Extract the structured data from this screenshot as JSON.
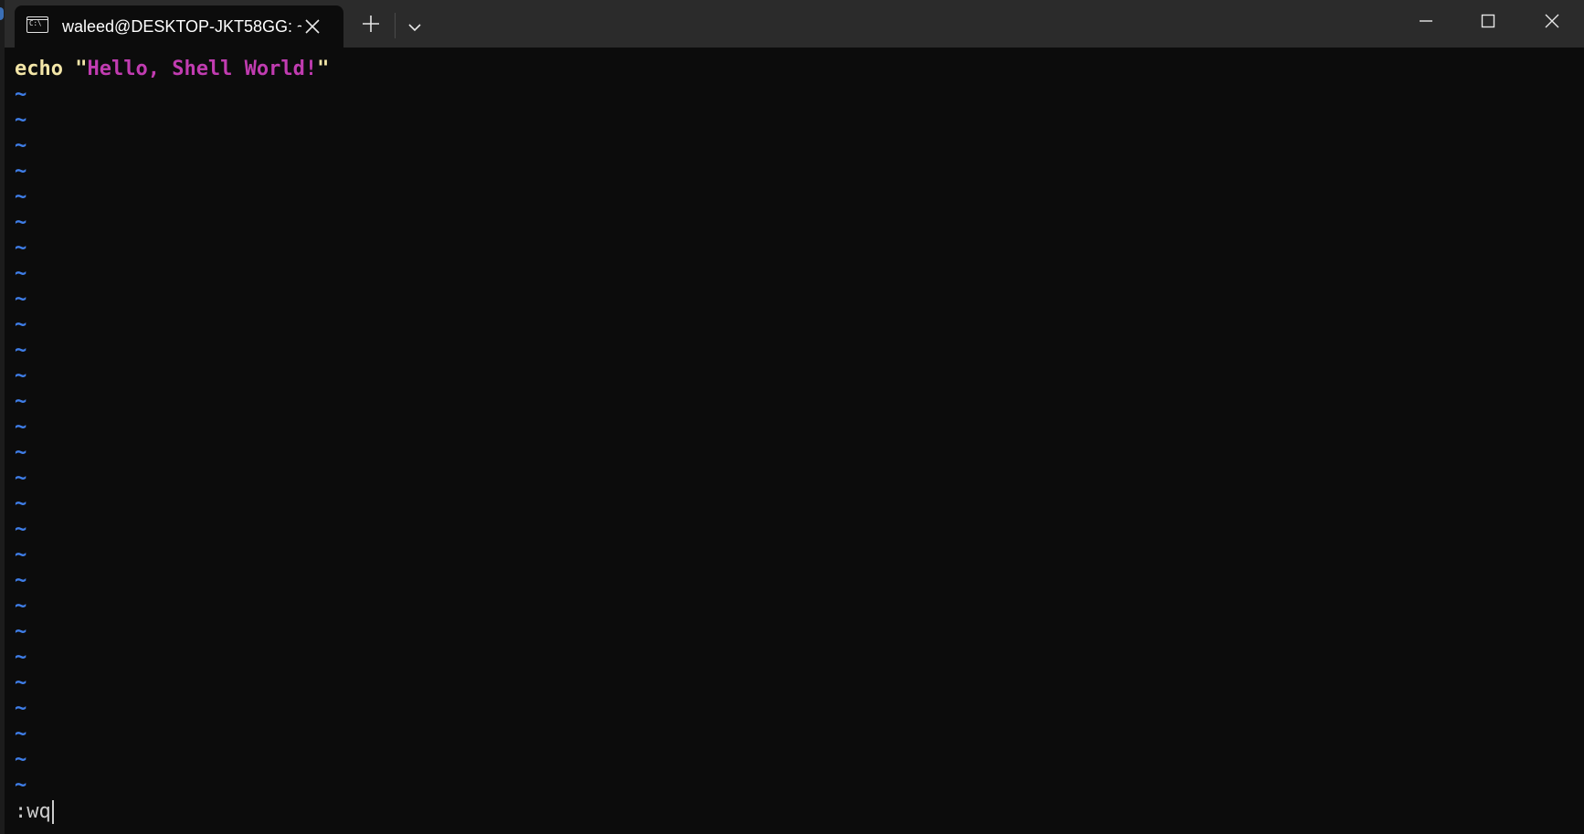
{
  "window": {
    "tab_title": "waleed@DESKTOP-JKT58GG: ~",
    "tab_icon_text": "C:\\"
  },
  "editor": {
    "keyword": "echo",
    "quote_open": "\"",
    "string_text": "Hello, Shell World!",
    "quote_close": "\"",
    "empty_line_marker": "~",
    "command_line": ":wq"
  },
  "colors": {
    "background": "#0c0c0c",
    "titlebar": "#2b2b2b",
    "keyword": "#f3e6a8",
    "string": "#c13cb1",
    "tilde": "#3f7ee8",
    "command": "#cccccc"
  },
  "icons": {
    "tab_icon": "terminal-icon",
    "tab_close": "close-icon",
    "new_tab": "plus-icon",
    "dropdown": "chevron-down-icon",
    "minimize": "minimize-icon",
    "maximize": "maximize-icon",
    "close": "close-icon"
  }
}
